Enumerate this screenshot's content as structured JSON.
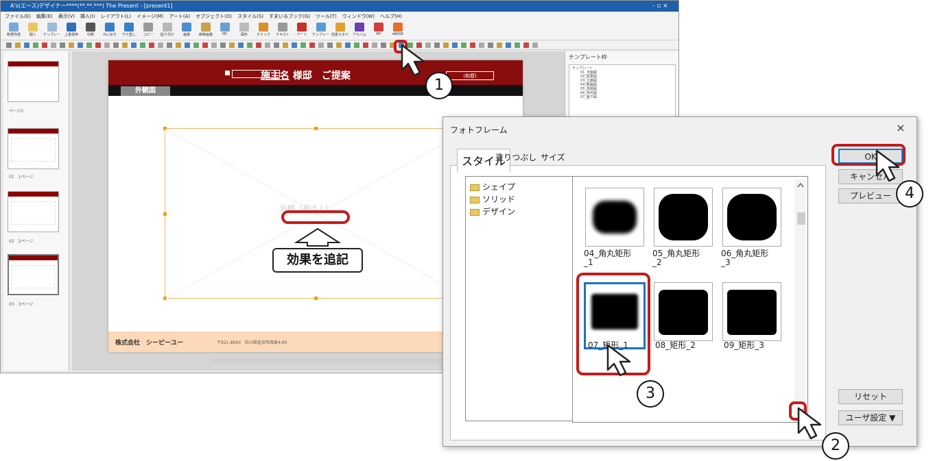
{
  "app": {
    "title": "A's(エース)デザイナー****(**.**.***) The Present - [present1]",
    "controls": "- ▫ ×",
    "menu": [
      "ファイル(E)",
      "編集(E)",
      "表示(V)",
      "挿入(I)",
      "レイアウト(L)",
      "イメージ(M)",
      "アート(A)",
      "オブジェクト(O)",
      "スタイル(S)",
      "すまいるブック(G)",
      "ツール(T)",
      "ウィンドウ(W)",
      "ヘルプ(H)"
    ],
    "toolbar": [
      "新規作成",
      "開く",
      "テンプレート作成",
      "上書保存",
      "印刷",
      "元に戻す",
      "やり直し",
      "コピー",
      "貼り付け",
      "画像",
      "線等画像",
      "MC",
      "図形",
      "クイック",
      "テキスト",
      "アート",
      "テンプレート枠",
      "前景スタイル",
      "アルバム",
      "MY",
      "eBASE"
    ]
  },
  "thumbs": [
    {
      "label": "ページ1"
    },
    {
      "label": "01　1ページ"
    },
    {
      "label": "02　2ページ"
    },
    {
      "label": "03　3ページ"
    }
  ],
  "slide": {
    "tab": "外観図",
    "title_name": "施主名",
    "title_rest": "様邸　ご提案",
    "wareki": "(和暦)",
    "placeholder": "外観（視点１）",
    "company": "株式会社　シーピーユー",
    "address": "〒921-8043　石川県金沢市西泉4-60"
  },
  "template_panel": {
    "title": "テンプレート枠",
    "tree": [
      "テンプレート",
      "01_平面図",
      "02_配置図",
      "03_立面図",
      "04_断面図",
      "05_透視図",
      "06_採光図",
      "07_面下図"
    ]
  },
  "annotation": "効果を追記",
  "callouts": [
    "1",
    "2",
    "3",
    "4"
  ],
  "dialog": {
    "title": "フォトフレーム",
    "close": "×",
    "tabs": [
      "スタイル",
      "塗りつぶし",
      "サイズ"
    ],
    "folders": [
      "シェイプ",
      "ソリッド",
      "デザイン"
    ],
    "shapes": [
      {
        "label": "04_角丸矩形\n_1"
      },
      {
        "label": "05_角丸矩形\n_2"
      },
      {
        "label": "06_角丸矩形\n_3"
      },
      {
        "label": "07_矩形_1"
      },
      {
        "label": "08_矩形_2"
      },
      {
        "label": "09_矩形_3"
      }
    ],
    "buttons": {
      "ok": "OK",
      "cancel": "キャンセル",
      "preview": "プレビュー",
      "reset": "リセット",
      "user": "ユーザ設定 ▼"
    }
  }
}
